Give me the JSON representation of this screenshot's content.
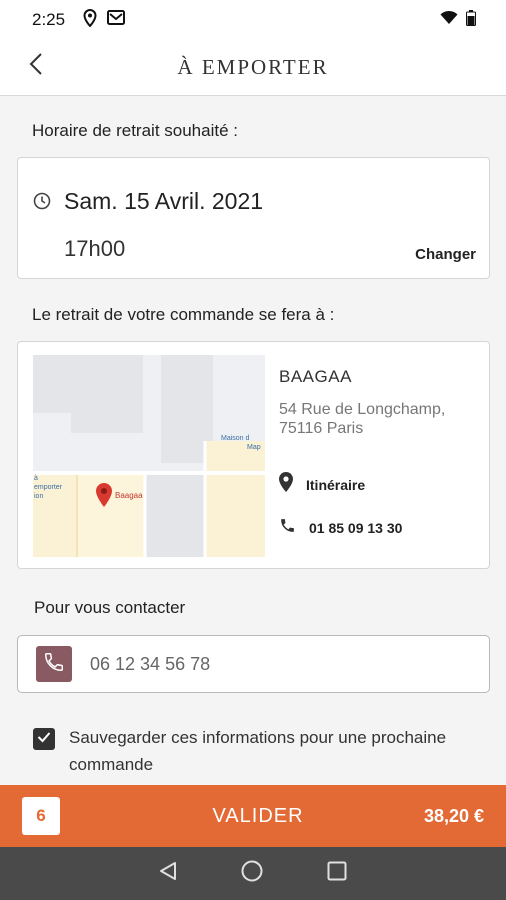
{
  "status_bar": {
    "time": "2:25"
  },
  "header": {
    "title": "À EMPORTER"
  },
  "pickup": {
    "label": "Horaire de retrait souhaité :",
    "date": "Sam. 15 Avril. 2021",
    "time": "17h00",
    "change_label": "Changer"
  },
  "location": {
    "label": "Le retrait de votre commande se fera à :",
    "store_name": "BAAGAA",
    "address": "54 Rue de Longchamp, 75116 Paris",
    "itinerary_label": "Itinéraire",
    "phone": "01 85 09 13 30",
    "map": {
      "pin_label": "Baagaa",
      "poi_label_line1": "Maison d",
      "poi_label_line2": "Map",
      "left_label_line1": "à",
      "left_label_line2": "emporter",
      "left_label_line3": "ion"
    }
  },
  "contact": {
    "label": "Pour vous contacter",
    "phone_value": "06 12 34 56 78"
  },
  "save_info": {
    "checked": true,
    "label": "Sauvegarder ces informations pour une prochaine commande"
  },
  "footer": {
    "item_count": "6",
    "validate_label": "VALIDER",
    "total": "38,20 €"
  },
  "colors": {
    "accent": "#e36a35",
    "contact_icon_bg": "#8a5a62",
    "nav_bar": "#4a4a4a"
  }
}
